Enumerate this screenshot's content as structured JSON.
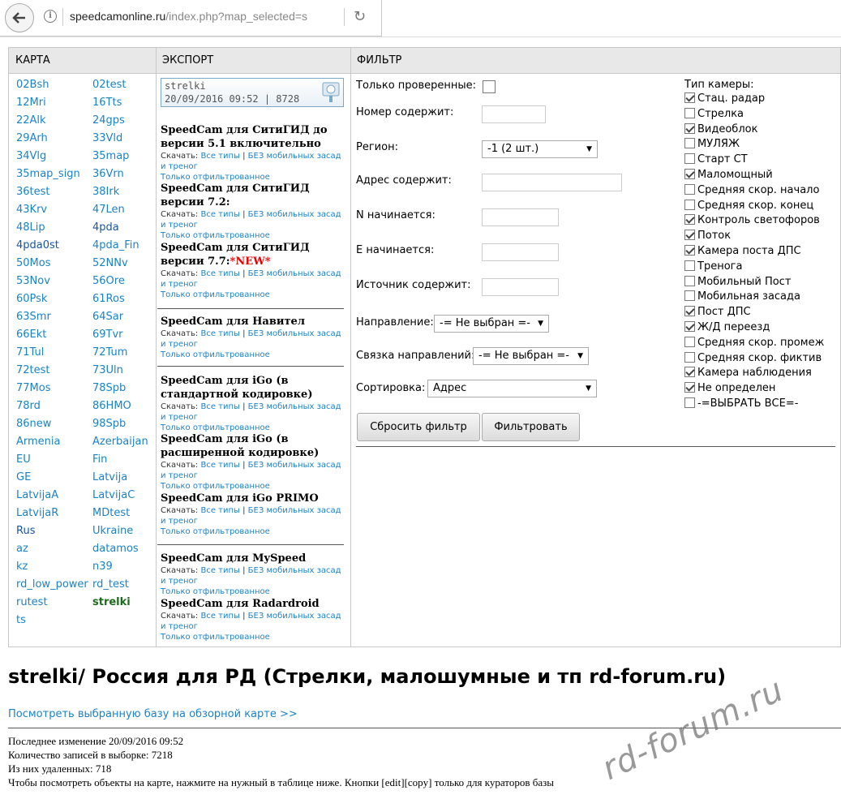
{
  "browser": {
    "url_host": "speedcamonline.ru",
    "url_path": "/index.php?map_selected=s",
    "reload_glyph": "↻"
  },
  "headers": {
    "map": "КАРТА",
    "export": "ЭКСПОРТ",
    "filter": "ФИЛЬТР"
  },
  "maps_left": [
    "02Bsh",
    "12Mri",
    "22Alk",
    "29Arh",
    "34Vlg",
    "35map_sign",
    "36test",
    "43Krv",
    "48Lip",
    "4pda0st",
    "50Mos",
    "53Nov",
    "60Psk",
    "63Smr",
    "66Ekt",
    "71Tul",
    "72test",
    "77Mos",
    "78rd",
    "86new",
    "Armenia",
    "EU",
    "GE",
    "LatvijaA",
    "LatvijaR",
    "Rus",
    "az",
    "kz",
    "rd_low_power",
    "rutest",
    "ts"
  ],
  "maps_right": [
    "02test",
    "16Tts",
    "24gps",
    "33Vld",
    "35map",
    "36Vrn",
    "38Irk",
    "47Len",
    "4pda",
    "4pda_Fin",
    "52NNv",
    "56Ore",
    "61Ros",
    "64Sar",
    "69Tvr",
    "72Tum",
    "73Uln",
    "78Spb",
    "86HMO",
    "98Spb",
    "Azerbaijan",
    "Fin",
    "Latvija",
    "LatvijaC",
    "MDtest",
    "Ukraine",
    "datamos",
    "n39",
    "rd_test",
    "strelki"
  ],
  "selected_map": "strelki",
  "banner": {
    "line1": "strelki",
    "line2": "20/09/2016 09:52 | 8728"
  },
  "export": {
    "download_label": "Скачать:",
    "all_types": "Все типы",
    "sep": "|",
    "no_mobile": "БЕЗ мобильных засад и треног",
    "filtered_only": "Только отфильтрованное",
    "new_tag": "*NEW*",
    "items": [
      "SpeedCam для СитиГИД до версии 5.1 включительно",
      "SpeedCam для СитиГИД версии 7.2:",
      "SpeedCam для СитиГИД версии 7.7:",
      "SpeedCam для Навител",
      "SpeedCam для iGo (в стандартной кодировке)",
      "SpeedCam для iGo (в расширенной кодировке)",
      "SpeedCam для iGo PRIMO",
      "SpeedCam для MySpeed",
      "SpeedCam для Radardroid"
    ]
  },
  "filter": {
    "verified_only": "Только проверенные:",
    "number_contains": "Номер содержит:",
    "region": "Регион:",
    "region_value": "-1 (2 шт.)",
    "address_contains": "Адрес содержит:",
    "n_starts": "N начинается:",
    "e_starts": "E начинается:",
    "source_contains": "Источник содержит:",
    "direction": "Направление:",
    "direction_value": "-= Не выбран =-",
    "direction_link": "Связка направлений:",
    "direction_link_value": "-= Не выбран =-",
    "sort": "Сортировка:",
    "sort_value": "Адрес",
    "reset_button": "Сбросить фильтр",
    "filter_button": "Фильтровать"
  },
  "camera_types": {
    "title": "Тип камеры:",
    "items": [
      {
        "label": "Стац. радар",
        "checked": true
      },
      {
        "label": "Стрелка",
        "checked": false
      },
      {
        "label": "Видеоблок",
        "checked": true
      },
      {
        "label": "МУЛЯЖ",
        "checked": false
      },
      {
        "label": "Старт СТ",
        "checked": false
      },
      {
        "label": "Маломощный",
        "checked": true
      },
      {
        "label": "Средняя скор. начало",
        "checked": false
      },
      {
        "label": "Средняя скор. конец",
        "checked": false
      },
      {
        "label": "Контроль светофоров",
        "checked": true
      },
      {
        "label": "Поток",
        "checked": true
      },
      {
        "label": "Камера поста ДПС",
        "checked": true
      },
      {
        "label": "Тренога",
        "checked": false
      },
      {
        "label": "Мобильный Пост",
        "checked": false
      },
      {
        "label": "Мобильная засада",
        "checked": false
      },
      {
        "label": "Пост ДПС",
        "checked": true
      },
      {
        "label": "Ж/Д переезд",
        "checked": true
      },
      {
        "label": "Средняя скор. промеж",
        "checked": false
      },
      {
        "label": "Средняя скор. фиктив",
        "checked": false
      },
      {
        "label": "Камера наблюдения",
        "checked": true
      },
      {
        "label": "Не определен",
        "checked": true
      },
      {
        "label": "-=ВЫБРАТЬ ВСЕ=-",
        "checked": false
      }
    ]
  },
  "page": {
    "title": "strelki/ Россия для РД (Стрелки, малошумные и тп rd-forum.ru)",
    "view_link": "Посмотреть выбранную базу на обзорной карте >>",
    "last_change": "Последнее изменение 20/09/2016 09:52",
    "count": "Количество записей в выборке: 7218",
    "deleted": "Из них удаленных: 718",
    "hint": "Чтобы посмотреть объекты на карте, нажмите на нужный в таблице ниже. Кнопки [edit][copy] только для кураторов базы",
    "watermark": "rd-forum.ru"
  }
}
